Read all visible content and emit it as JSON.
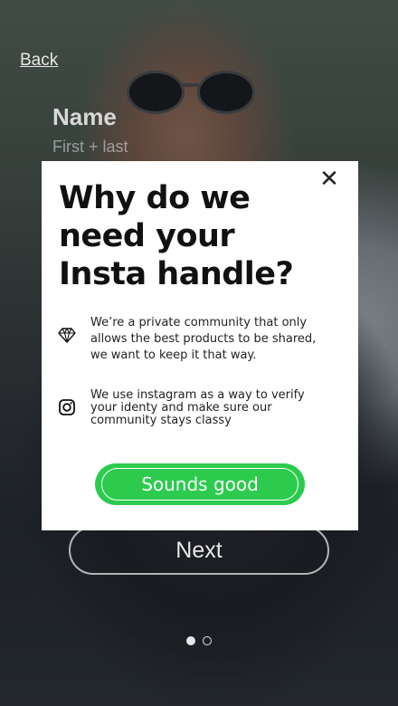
{
  "background_screen": {
    "back_label": "Back",
    "name_label": "Name",
    "name_placeholder": "First + last",
    "next_label": "Next",
    "pager": {
      "total": 2,
      "active_index": 0
    }
  },
  "modal": {
    "title": "Why do we need your Insta handle?",
    "close_icon": "close-icon",
    "items": [
      {
        "icon": "diamond-icon",
        "text": "We’re a private community that only allows the best products to be shared, we want to keep it that way."
      },
      {
        "icon": "instagram-icon",
        "text": "We use instagram as a way to verify your identy and make sure our community stays classy"
      }
    ],
    "confirm_label": "Sounds good"
  },
  "colors": {
    "accent_green": "#2CCB4E",
    "modal_bg": "#FFFFFF",
    "title_text": "#111111"
  }
}
